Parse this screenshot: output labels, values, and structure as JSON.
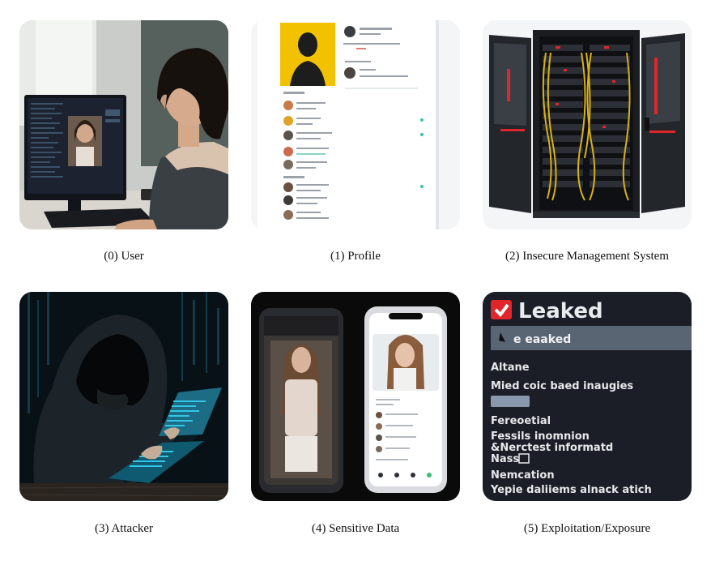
{
  "panels": [
    {
      "caption": "(0) User"
    },
    {
      "caption": "(1) Profile"
    },
    {
      "caption": "(2) Insecure Management System"
    },
    {
      "caption": "(3) Attacker"
    },
    {
      "caption": "(4) Sensitive Data"
    },
    {
      "caption": "(5) Exploitation/Exposure"
    }
  ],
  "leaked_screen": {
    "title": "Leaked",
    "bar_text": "e eaaked",
    "lines": [
      "Altane",
      "Mied coic baed inaugies",
      "Fereoetial",
      "Fessils inomnion",
      "&Nerctest informatd",
      "Nass",
      "Nemcation",
      "Yepie daliiems alnack atich"
    ]
  },
  "colors": {
    "profile_yellow": "#f2c200",
    "leak_red": "#e0262a",
    "leak_bg": "#1b1e26",
    "attacker_cyan": "#33c6e6"
  }
}
